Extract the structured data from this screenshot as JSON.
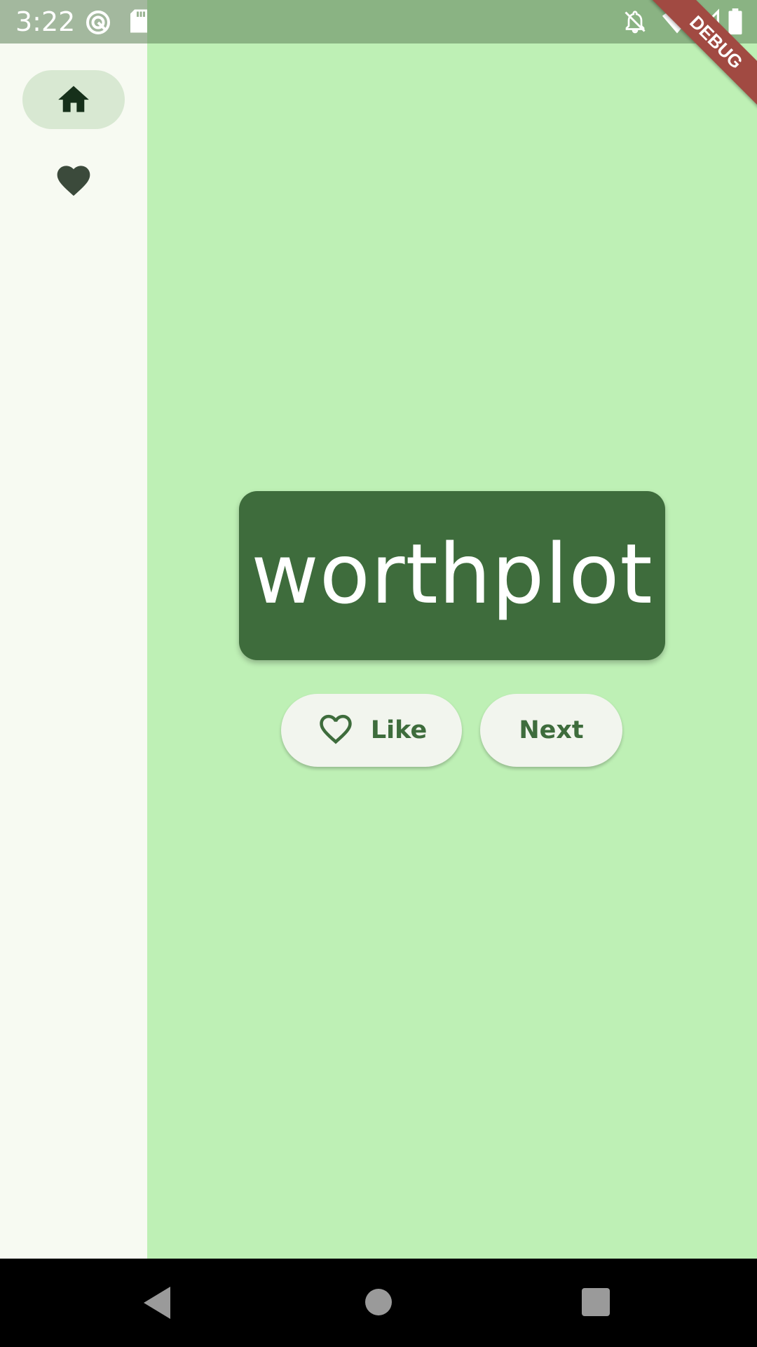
{
  "status_bar": {
    "time": "3:22",
    "icons": [
      "sync-icon",
      "sd-card-icon",
      "notifications-off-icon",
      "wifi-icon",
      "cell-signal-icon",
      "battery-icon"
    ]
  },
  "debug_banner": {
    "label": "DEBUG"
  },
  "nav_rail": {
    "items": [
      {
        "icon": "home-icon",
        "selected": true
      },
      {
        "icon": "favorite-icon",
        "selected": false
      }
    ]
  },
  "word_card": {
    "text": "worthplot"
  },
  "actions": {
    "like_label": "Like",
    "like_icon": "favorite-border-icon",
    "next_label": "Next"
  },
  "system_nav": {
    "icons": [
      "back-icon",
      "home-circle-icon",
      "recents-icon"
    ]
  },
  "colors": {
    "main_bg": "#bef0b5",
    "rail_bg": "#f7faf2",
    "card_bg": "#3e6c3c",
    "button_bg": "#f2f5ee",
    "accent": "#3e6c3c"
  }
}
